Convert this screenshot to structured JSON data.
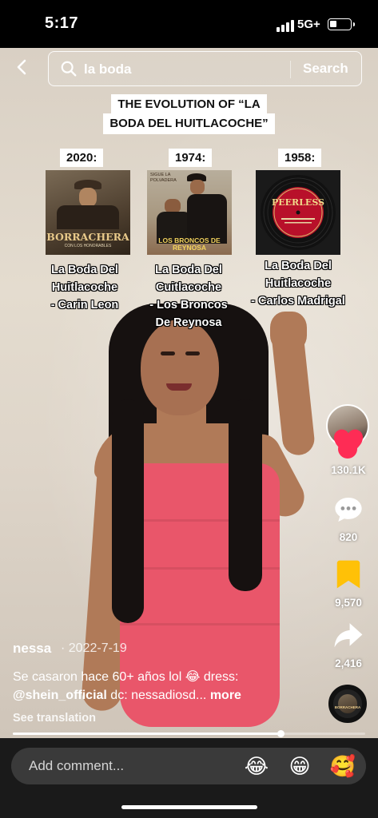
{
  "status_bar": {
    "time": "5:17",
    "network": "5G+"
  },
  "search": {
    "query": "la boda",
    "button_label": "Search"
  },
  "overlay": {
    "title_line1": "THE EVOLUTION OF “LA",
    "title_line2": "BODA DEL HUITLACOCHE”",
    "entries": [
      {
        "year": "2020:",
        "cover_text": "BORRACHERA",
        "cover_subtext": "CON LOS HONORABLES",
        "caption_lines": [
          "La Boda Del",
          "Huitlacoche",
          "- Carin Leon"
        ]
      },
      {
        "year": "1974:",
        "cover_text": "LOS BRONCOS DE REYNOSA",
        "cover_subtext": "SIGUE LA POLVADERA",
        "caption_lines": [
          "La Boda Del",
          "Cuitlacoche",
          "- Los Broncos",
          "De Reynosa"
        ]
      },
      {
        "year": "1958:",
        "cover_text": "PEERLESS",
        "cover_subtext": "",
        "caption_lines": [
          "La Boda Del",
          "Huitlacoche",
          "- Carlos Madrigal"
        ]
      }
    ]
  },
  "actions": {
    "likes": "130.1K",
    "comments": "820",
    "saves": "9,570",
    "shares": "2,416",
    "follow_symbol": "+",
    "like_color": "#fe2c55",
    "save_color": "#ffc107"
  },
  "post": {
    "author": "nessa",
    "date": "· 2022-7-19",
    "desc_line1": "Se casaron hace 60+ años lol 😂 dress:",
    "mention": "@shein_official",
    "desc_line2_rest": " dc: nessadiosd...",
    "more_label": "more",
    "see_translation": "See translation",
    "progress": 0.76,
    "disc_text": "BORRACHERA"
  },
  "comment_bar": {
    "placeholder": "Add comment...",
    "emojis": [
      "😂",
      "😁",
      "🥰"
    ]
  }
}
